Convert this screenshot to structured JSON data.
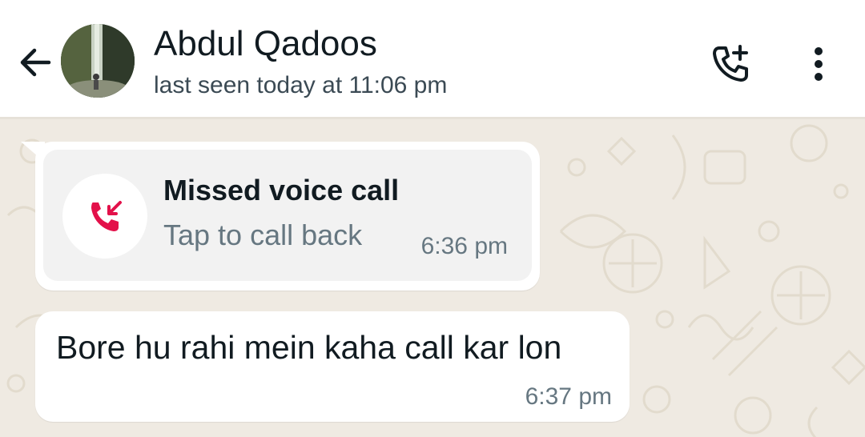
{
  "header": {
    "contact_name": "Abdul Qadoos",
    "last_seen": "last seen today at 11:06 pm",
    "back_icon": "arrow-left-icon",
    "add_call_icon": "phone-plus-icon",
    "menu_icon": "more-vertical-icon"
  },
  "messages": [
    {
      "type": "missed-call",
      "title": "Missed voice call",
      "subtitle": "Tap to call back",
      "time": "6:36 pm",
      "icon": "missed-call-icon"
    },
    {
      "type": "text",
      "text": "Bore hu rahi mein kaha call kar lon",
      "time": "6:37 pm"
    }
  ],
  "colors": {
    "header_bg": "#ffffff",
    "chat_bg": "#efeae2",
    "bubble_bg": "#ffffff",
    "call_card_bg": "#f2f2f2",
    "missed_call_red": "#e3114a",
    "text_primary": "#111b21",
    "text_secondary": "#667781"
  }
}
